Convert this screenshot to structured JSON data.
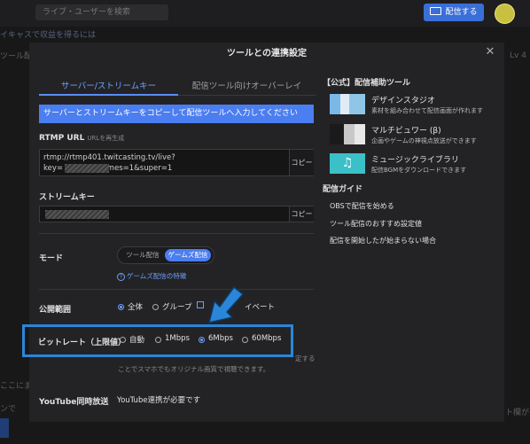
{
  "header": {
    "search_placeholder": "ライブ・ユーザーを検索",
    "broadcast_label": "配信する"
  },
  "background": {
    "promo_text": "イキャスで収益を得るには",
    "left_text_1": "ツール配",
    "left_text_2": "ここにま",
    "left_text_3": "ンで",
    "right_text_1": "Lv 4",
    "right_text_2": "ト欄が"
  },
  "modal": {
    "title": "ツールとの連携設定",
    "tabs": [
      {
        "label": "サーバー/ストリームキー",
        "active": true
      },
      {
        "label": "配信ツール向けオーバーレイ",
        "active": false
      }
    ],
    "info_text": "サーバーとストリームキーをコピーして配信ツールへ入力してください",
    "rtmp": {
      "label": "RTMP URL",
      "sub_label": "URLを再生成",
      "url_line1": "rtmp://rtmp401.twitcasting.tv/live?",
      "url_line2_prefix": "key=",
      "url_line2_suffix": "&games=1&super=1",
      "copy_label": "コピー"
    },
    "stream_key": {
      "label": "ストリームキー",
      "copy_label": "コピー"
    },
    "mode": {
      "label": "モード",
      "options": [
        "ツール配信",
        "ゲームズ配信"
      ],
      "selected": "ゲームズ配信",
      "help_link": "ゲームズ配信の特徴"
    },
    "visibility": {
      "label": "公開範囲",
      "options": [
        "全体",
        "グループ",
        "プライベート"
      ],
      "selected": "全体",
      "private_visible_text": "イベート"
    },
    "bitrate": {
      "label": "ビットレート（上限値）",
      "options": [
        "自動",
        "1Mbps",
        "6Mbps",
        "60Mbps"
      ],
      "selected": "6Mbps",
      "note_line1": "視聴者に届く画質は自動で調整されるため、60Mbpsに設定する",
      "note_line1_visible": "定する",
      "note_line2": "ことでスマホでもオリジナル画質で視聴できます。"
    },
    "youtube": {
      "label": "YouTube同時放送",
      "value": "YouTube連携が必要です"
    },
    "tools_heading": "【公式】配信補助ツール",
    "tools": [
      {
        "name": "デザインスタジオ",
        "desc": "素材を組み合わせて配信画面が作れます"
      },
      {
        "name": "マルチビュワー (β)",
        "desc": "企画やゲームの神視点放送ができます"
      },
      {
        "name": "ミュージックライブラリ",
        "desc": "配信BGMをダウンロードできます"
      }
    ],
    "guide_heading": "配信ガイド",
    "guides": [
      "OBSで配信を始める",
      "ツール配信のおすすめ設定値",
      "配信を開始したが始まらない場合"
    ]
  },
  "colors": {
    "accent": "#4b7ef0",
    "highlight_border": "#2a86d8",
    "cursor_fill": "#2a86d8"
  }
}
